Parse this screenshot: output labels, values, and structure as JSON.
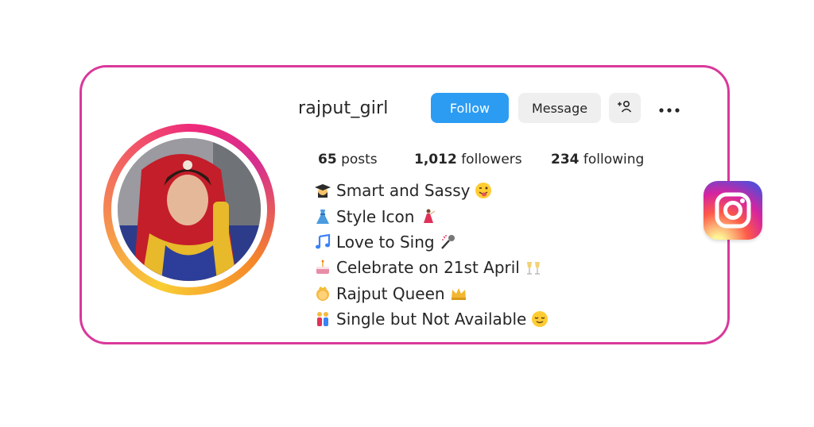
{
  "profile": {
    "username": "rajput_girl",
    "avatar_icon": "profile-photo"
  },
  "actions": {
    "follow_label": "Follow",
    "message_label": "Message",
    "add_user_icon": "add-user-icon",
    "more_icon": "more-options-icon"
  },
  "stats": {
    "posts_count": "65",
    "posts_label": "posts",
    "followers_count": "1,012",
    "followers_label": "followers",
    "following_count": "234",
    "following_label": "following"
  },
  "bio": [
    {
      "icon": "graduation-cap-icon",
      "text": "Smart and Sassy",
      "end_icon": "winking-tongue-face-icon"
    },
    {
      "icon": "dress-icon",
      "text": "Style Icon",
      "end_icon": "dancer-icon"
    },
    {
      "icon": "music-notes-icon",
      "text": "Love to Sing",
      "end_icon": "microphone-icon"
    },
    {
      "icon": "birthday-cake-icon",
      "text": "Celebrate on 21st April",
      "end_icon": "clinking-glasses-icon"
    },
    {
      "icon": "princess-icon",
      "text": "Rajput Queen",
      "end_icon": "crown-icon"
    },
    {
      "icon": "couple-icon",
      "text": "Single but Not Available",
      "end_icon": "relieved-face-icon"
    }
  ],
  "brand": {
    "logo": "instagram-logo",
    "card_border_color": "#d9389b",
    "follow_color": "#2c9cf3"
  }
}
